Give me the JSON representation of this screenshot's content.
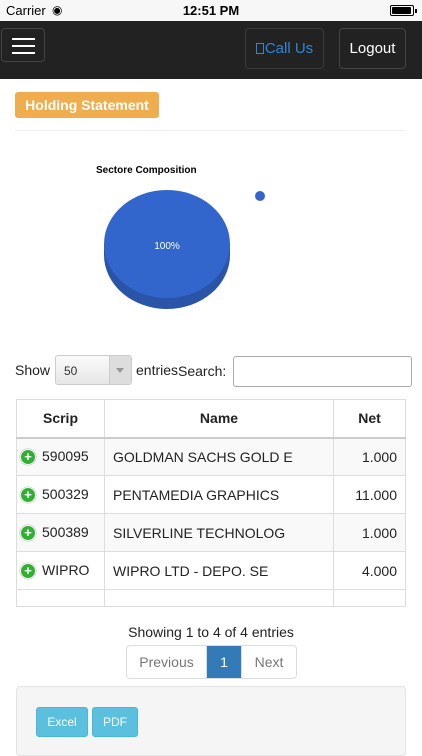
{
  "status_bar": {
    "carrier": "Carrier",
    "time": "12:51 PM"
  },
  "navbar": {
    "call_label": "Call Us",
    "logout_label": "Logout"
  },
  "page": {
    "badge": "Holding Statement"
  },
  "chart": {
    "title": "Sectore Composition",
    "slice_label": "100%"
  },
  "chart_data": {
    "type": "pie",
    "title": "Sectore Composition",
    "slices": [
      {
        "value": 100,
        "label": "100%",
        "color": "#3366cc"
      }
    ],
    "legend": "right"
  },
  "controls": {
    "show_label": "Show",
    "page_length": "50",
    "entries_label": "entries",
    "search_label": "Search:",
    "search_value": ""
  },
  "table": {
    "headers": [
      "Scrip",
      "Name",
      "Net"
    ],
    "rows": [
      {
        "scrip": "590095",
        "name": "GOLDMAN SACHS GOLD E",
        "net": "1.000"
      },
      {
        "scrip": "500329",
        "name": "PENTAMEDIA GRAPHICS",
        "net": "11.000"
      },
      {
        "scrip": "500389",
        "name": "SILVERLINE TECHNOLOG",
        "net": "1.000"
      },
      {
        "scrip": "WIPRO",
        "name": "WIPRO LTD - DEPO. SE",
        "net": "4.000"
      }
    ]
  },
  "pagination": {
    "info": "Showing 1 to 4 of 4 entries",
    "previous": "Previous",
    "current": "1",
    "next": "Next"
  },
  "export": {
    "excel": "Excel",
    "pdf": "PDF"
  },
  "colors": {
    "navbar": "#222222",
    "badge": "#f0ad4e",
    "pie": "#3366cc",
    "page_active": "#337ab7",
    "export_button": "#5bc0de",
    "expand_icon": "#31b131"
  }
}
